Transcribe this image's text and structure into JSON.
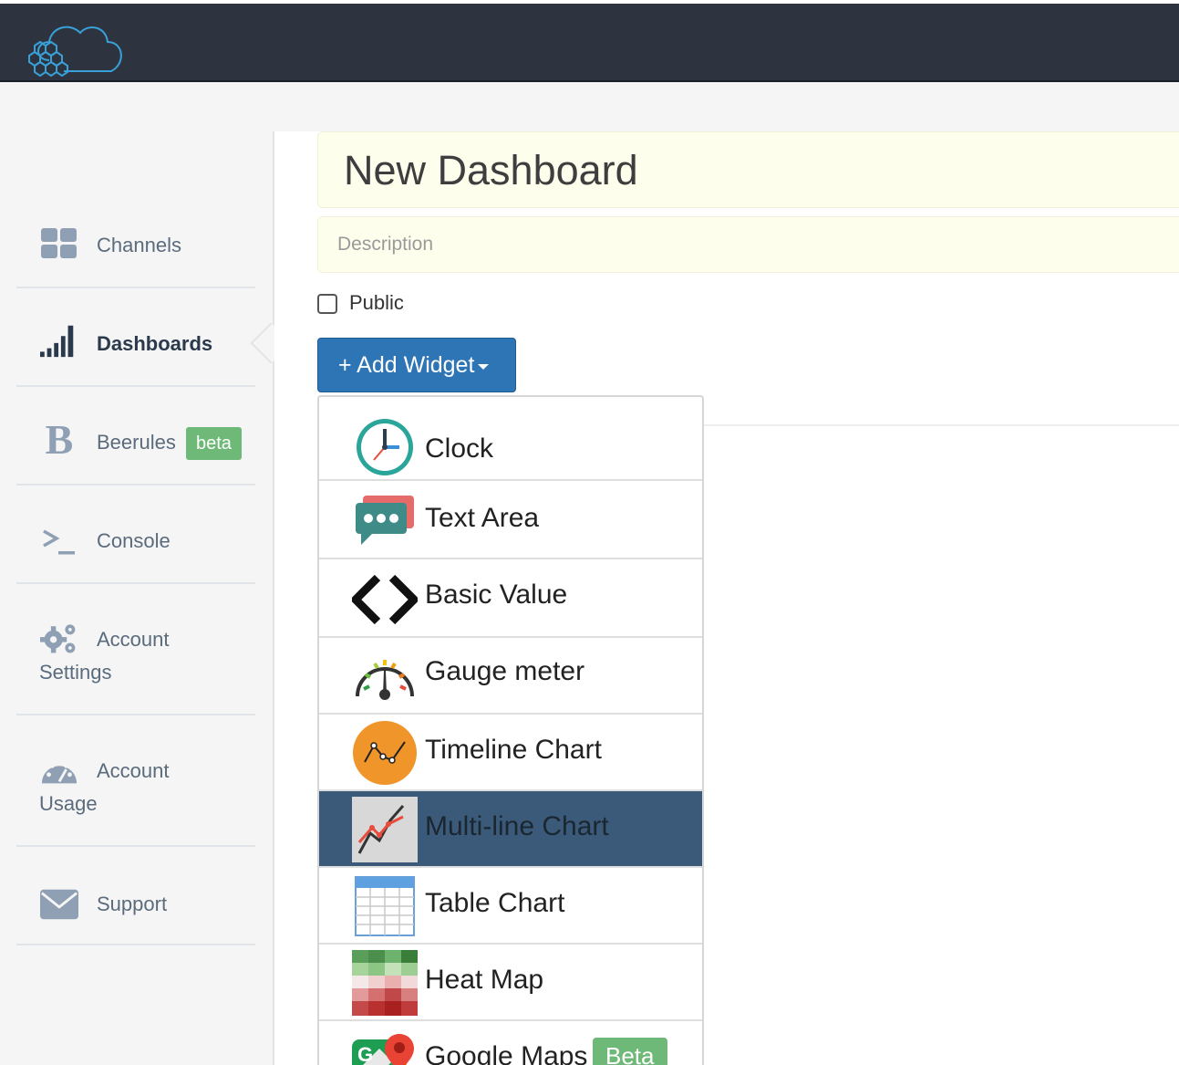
{
  "header": {
    "logo": "beebotte-cloud-logo"
  },
  "sidebar": {
    "items": [
      {
        "label": "Channels",
        "icon": "grid-icon"
      },
      {
        "label": "Dashboards",
        "icon": "signal-bars-icon",
        "active": true
      },
      {
        "label": "Beerules",
        "icon": "b-letter-icon",
        "badge": "beta"
      },
      {
        "label": "Console",
        "icon": "terminal-icon"
      },
      {
        "label": "Account",
        "label2": "Settings",
        "icon": "gears-icon"
      },
      {
        "label": "Account",
        "label2": "Usage",
        "icon": "speedometer-icon"
      },
      {
        "label": "Support",
        "icon": "envelope-icon"
      }
    ]
  },
  "dashboard": {
    "title": "New Dashboard",
    "description_placeholder": "Description",
    "public_label": "Public",
    "public_checked": false,
    "add_widget_label": "+ Add Widget"
  },
  "widget_menu": {
    "items": [
      {
        "label": "Clock",
        "icon": "clock-icon"
      },
      {
        "label": "Text Area",
        "icon": "chat-bubbles-icon"
      },
      {
        "label": "Basic Value",
        "icon": "code-brackets-icon"
      },
      {
        "label": "Gauge meter",
        "icon": "gauge-icon"
      },
      {
        "label": "Timeline Chart",
        "icon": "timeline-chart-icon"
      },
      {
        "label": "Multi-line Chart",
        "icon": "multiline-chart-icon",
        "selected": true
      },
      {
        "label": "Table Chart",
        "icon": "table-icon"
      },
      {
        "label": "Heat Map",
        "icon": "heatmap-icon"
      },
      {
        "label": "Google Maps",
        "icon": "google-maps-icon",
        "badge": "Beta"
      }
    ]
  },
  "colors": {
    "topbar": "#2d3440",
    "accent": "#2e75b5",
    "selected": "#3b5a7a",
    "badge": "#6fb978"
  }
}
